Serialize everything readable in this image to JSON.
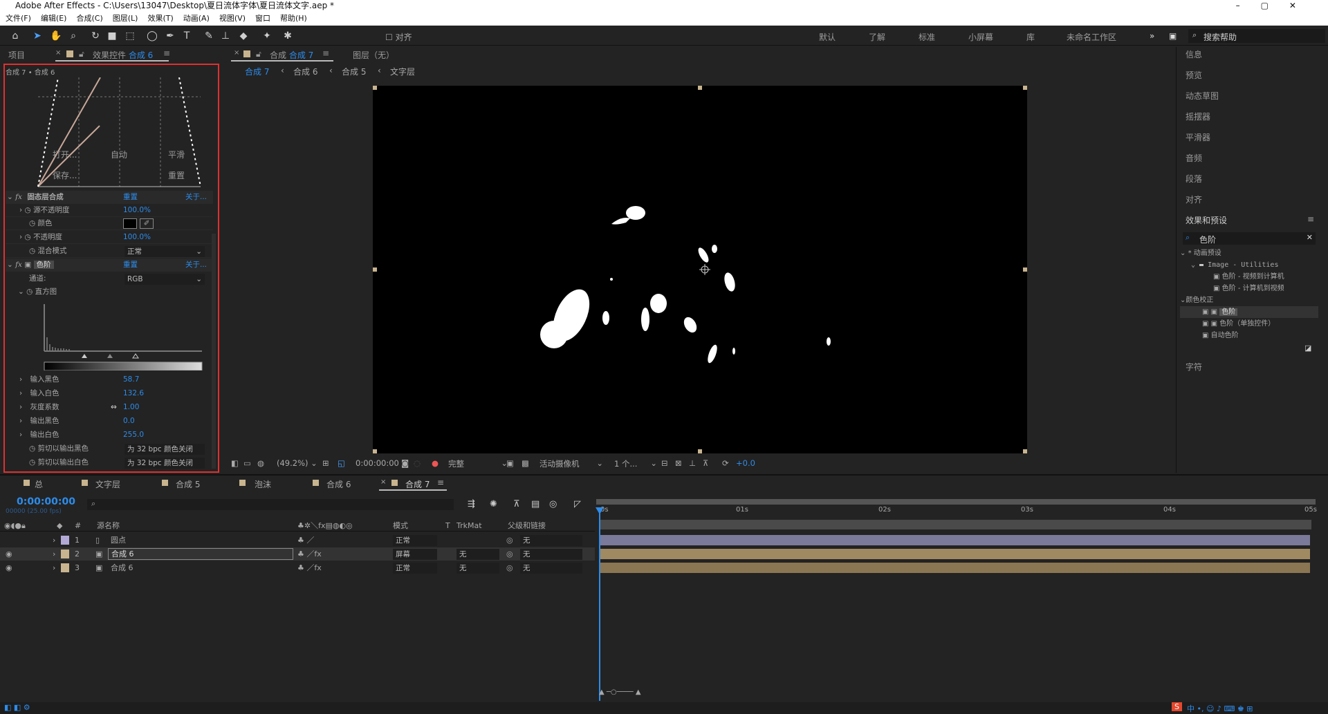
{
  "window": {
    "title": "Adobe After Effects - C:\\Users\\13047\\Desktop\\夏日流体字体\\夏日流体文字.aep *"
  },
  "menu": [
    "文件(F)",
    "编辑(E)",
    "合成(C)",
    "图层(L)",
    "效果(T)",
    "动画(A)",
    "视图(V)",
    "窗口",
    "帮助(H)"
  ],
  "toolbar": {
    "align_label": "对齐",
    "workspaces": [
      "默认",
      "了解",
      "标准",
      "小屏幕",
      "库",
      "未命名工作区"
    ],
    "search_placeholder": "搜索帮助"
  },
  "left_panel": {
    "tabs": [
      "项目",
      "效果控件"
    ],
    "active_comp": "合成 6",
    "breadcrumb": "合成 7 • 合成 6",
    "curve_buttons": {
      "open": "打开...",
      "auto": "自动",
      "smooth": "平滑",
      "save": "保存...",
      "reset": "重置"
    },
    "effect1": {
      "name": "固态层合成",
      "reset": "重置",
      "about": "关于...",
      "props": [
        {
          "label": "源不透明度",
          "value": "100.0%"
        },
        {
          "label": "颜色",
          "value": ""
        },
        {
          "label": "不透明度",
          "value": "100.0%"
        },
        {
          "label": "混合模式",
          "value": "正常"
        }
      ]
    },
    "effect2": {
      "name": "色阶",
      "reset": "重置",
      "about": "关于...",
      "channel_label": "通道:",
      "channel_value": "RGB",
      "histogram_label": "直方图",
      "props": [
        {
          "label": "输入黑色",
          "value": "58.7"
        },
        {
          "label": "输入白色",
          "value": "132.6"
        },
        {
          "label": "灰度系数",
          "value": "1.00"
        },
        {
          "label": "输出黑色",
          "value": "0.0"
        },
        {
          "label": "输出白色",
          "value": "255.0"
        }
      ],
      "clip_black_label": "剪切以输出黑色",
      "clip_black_value": "为 32 bpc 颜色关闭",
      "clip_white_label": "剪切以输出白色",
      "clip_white_value": "为 32 bpc 颜色关闭"
    }
  },
  "viewer": {
    "tab_comp": "合成",
    "tab_comp_name": "合成 7",
    "layer_tab": "图层（无）",
    "breadcrumbs": [
      "合成 7",
      "合成 6",
      "合成 5",
      "文字层"
    ],
    "zoom": "(49.2%)",
    "timecode": "0:00:00:00",
    "resolution": "完整",
    "camera": "活动摄像机",
    "views": "1 个...",
    "exposure": "+0.0"
  },
  "right_panel": {
    "items": [
      "信息",
      "预览",
      "动态草图",
      "摇摆器",
      "平滑器",
      "音频",
      "段落",
      "对齐"
    ],
    "effects_title": "效果和预设",
    "search_value": "色阶",
    "tree": [
      {
        "label": "* 动画预设",
        "level": 0
      },
      {
        "label": "Image - Utilities",
        "level": 1
      },
      {
        "label": "色阶 - 视频到计算机",
        "level": 2
      },
      {
        "label": "色阶 - 计算机到视频",
        "level": 2
      },
      {
        "label": "颜色校正",
        "level": 0
      },
      {
        "label": "色阶",
        "level": 2,
        "selected": true
      },
      {
        "label": "色阶（单独控件）",
        "level": 2
      },
      {
        "label": "自动色阶",
        "level": 2
      }
    ],
    "char_label": "字符"
  },
  "timeline": {
    "tabs": [
      "总",
      "文字层",
      "合成 5",
      "泡沫",
      "合成 6",
      "合成 7"
    ],
    "timecode": "0:00:00:00",
    "frame_info": "00000 (25.00 fps)",
    "headers": {
      "num": "#",
      "source": "源名称",
      "mode": "模式",
      "t": "T",
      "trkmat": "TrkMat",
      "parent": "父级和链接"
    },
    "ruler": [
      "0s",
      "01s",
      "02s",
      "03s",
      "04s",
      "05s"
    ],
    "layers": [
      {
        "num": "1",
        "name": "圆点",
        "mode": "正常",
        "trkmat": "",
        "parent": "无",
        "color": "#b3a9d6"
      },
      {
        "num": "2",
        "name": "合成 6",
        "mode": "屏幕",
        "trkmat": "无",
        "parent": "无",
        "color": "#c8b48e"
      },
      {
        "num": "3",
        "name": "合成 6",
        "mode": "正常",
        "trkmat": "无",
        "parent": "无",
        "color": "#c8b48e"
      }
    ]
  },
  "colors": {
    "accent": "#2d8ceb",
    "highlight_border": "#e03030"
  }
}
